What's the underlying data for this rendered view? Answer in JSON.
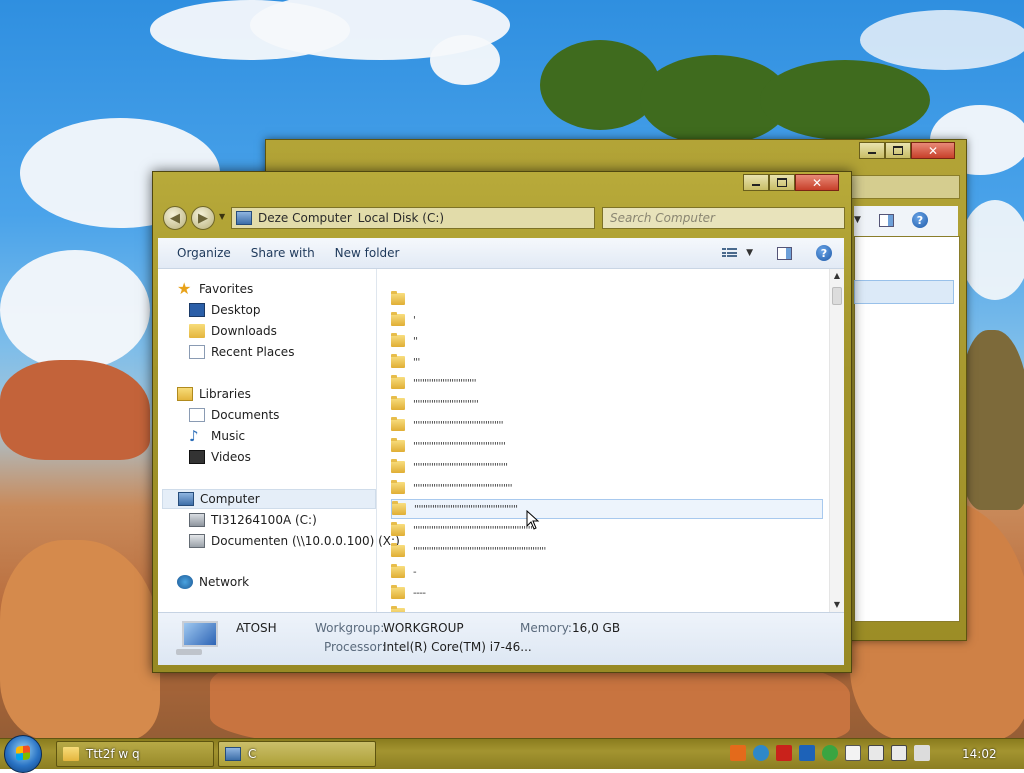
{
  "back_window": {
    "address_text": "Deze Computer"
  },
  "front_window": {
    "address": {
      "crumbs": [
        "Deze Computer",
        "Local Disk (C:)"
      ]
    },
    "search": {
      "placeholder": "Search Computer"
    },
    "toolbar": {
      "organize": "Organize",
      "share_with": "Share with",
      "new_folder": "New folder"
    },
    "nav": {
      "favorites": "Favorites",
      "desktop": "Desktop",
      "downloads": "Downloads",
      "recent_places": "Recent Places",
      "libraries": "Libraries",
      "documents": "Documents",
      "music": "Music",
      "videos": "Videos",
      "computer": "Computer",
      "drive_c": "TI31264100A (C:)",
      "drive_x": "Documenten (\\\\10.0.0.100) (X:)",
      "network": "Network"
    },
    "files": [
      "",
      "'",
      "''",
      "'''",
      "''''''''''''''''''''''''''''",
      "'''''''''''''''''''''''''''''",
      "''''''''''''''''''''''''''''''''''''''''",
      "'''''''''''''''''''''''''''''''''''''''''",
      "''''''''''''''''''''''''''''''''''''''''''",
      "''''''''''''''''''''''''''''''''''''''''''''",
      "''''''''''''''''''''''''''''''''''''''''''''''",
      "'''''''''''''''''''''''''''''''''''''''''''''''''''''",
      "'''''''''''''''''''''''''''''''''''''''''''''''''''''''''''",
      "-",
      "----",
      ""
    ],
    "selected_file_index": 10,
    "details": {
      "computer_name": "ATOSH",
      "workgroup_label": "Workgroup:",
      "workgroup_value": "WORKGROUP",
      "memory_label": "Memory:",
      "memory_value": "16,0 GB",
      "processor_label": "Processor:",
      "processor_value": "Intel(R) Core(TM) i7-46..."
    }
  },
  "taskbar": {
    "items": [
      "Ttt2f w q",
      "C"
    ],
    "clock": "14:02",
    "tray_icons": [
      "vlc-icon",
      "network-globe-icon",
      "pdf-icon",
      "outlook-icon",
      "security-check-icon",
      "action-center-icon",
      "device-icon",
      "network-icon",
      "volume-icon"
    ]
  }
}
